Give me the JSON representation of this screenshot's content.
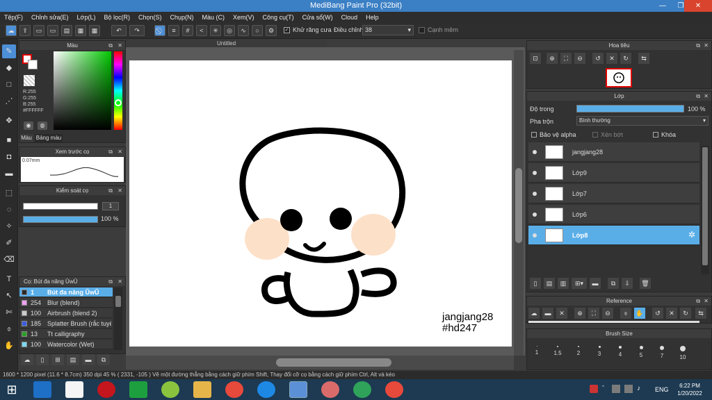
{
  "window": {
    "title": "MediBang Paint Pro (32bit)"
  },
  "menu": [
    "Tệp(F)",
    "Chỉnh sửa(E)",
    "Lớp(L)",
    "Bộ lọc(R)",
    "Chọn(S)",
    "Chụp(N)",
    "Màu (C)",
    "Xem(V)",
    "Công cụ(T)",
    "Cửa sổ(W)",
    "Cloud",
    "Help"
  ],
  "toolbar": {
    "antialias_label": "Khử răng cưa",
    "adjust_label": "Điều chỉnh",
    "adjust_value": "38",
    "sharp_label": "Cạnh mềm"
  },
  "color_panel": {
    "title": "Màu",
    "r": "R:255",
    "g": "G:255",
    "b": "B:255",
    "hex": "#FFFFFF",
    "tab_color": "Màu",
    "tab_palette": "Bảng màu"
  },
  "brush_preview": {
    "title": "Xem trước cọ",
    "size": "0.07mm"
  },
  "brush_control": {
    "title": "Kiểm soát cọ",
    "size_value": "1",
    "opacity_value": "100 %"
  },
  "brush_list": {
    "title": "Cọ: Bút đa năng ŬwŬ",
    "items": [
      {
        "num": "1",
        "name": "Bút đa năng ŬwŬ",
        "color": "#2a2a2a"
      },
      {
        "num": "254",
        "name": "Blur (blend)",
        "color": "#f0a0f0"
      },
      {
        "num": "100",
        "name": "Airbrush (blend 2)",
        "color": "#cccccc"
      },
      {
        "num": "185",
        "name": "Splatter Brush (rắc tuyế",
        "color": "#3a5de0"
      },
      {
        "num": "13",
        "name": "Tt calligraphy",
        "color": "#2aa02a"
      },
      {
        "num": "100",
        "name": "Watercolor (Wet)",
        "color": "#7fd8f0"
      }
    ]
  },
  "canvas": {
    "tab": "Untitled",
    "signature_line1": "jangjang28",
    "signature_line2": "#hd247"
  },
  "navigator": {
    "title": "Hoa tiêu"
  },
  "layer_panel": {
    "title": "Lớp",
    "opacity_label": "Độ trong",
    "opacity_value": "100 %",
    "blend_label": "Pha trộn",
    "blend_value": "Bình thường",
    "protect_alpha": "Bảo vệ alpha",
    "clipping": "Xén bớt",
    "lock": "Khóa",
    "layers": [
      {
        "name": "jangjang28",
        "selected": false
      },
      {
        "name": "Lớp9",
        "selected": false
      },
      {
        "name": "Lớp7",
        "selected": false
      },
      {
        "name": "Lớp6",
        "selected": false
      },
      {
        "name": "Lớp8",
        "selected": true
      }
    ]
  },
  "reference_panel": {
    "title": "Reference"
  },
  "brush_size": {
    "title": "Brush Size",
    "sizes": [
      "1",
      "1.5",
      "2",
      "3",
      "4",
      "5",
      "7",
      "10"
    ]
  },
  "status": {
    "text": "1600 * 1200 pixel   (11.6 * 8.7cm)   350 dpi   45 %   ( 2331, -105 )   Vẽ một đường thẳng bằng cách giữ phím Shift, Thay đổi cỡ cọ bằng cách giữ phím Ctrl, Alt và kéo"
  },
  "taskbar": {
    "lang": "ENG",
    "time": "6:22 PM",
    "date": "1/20/2022"
  }
}
